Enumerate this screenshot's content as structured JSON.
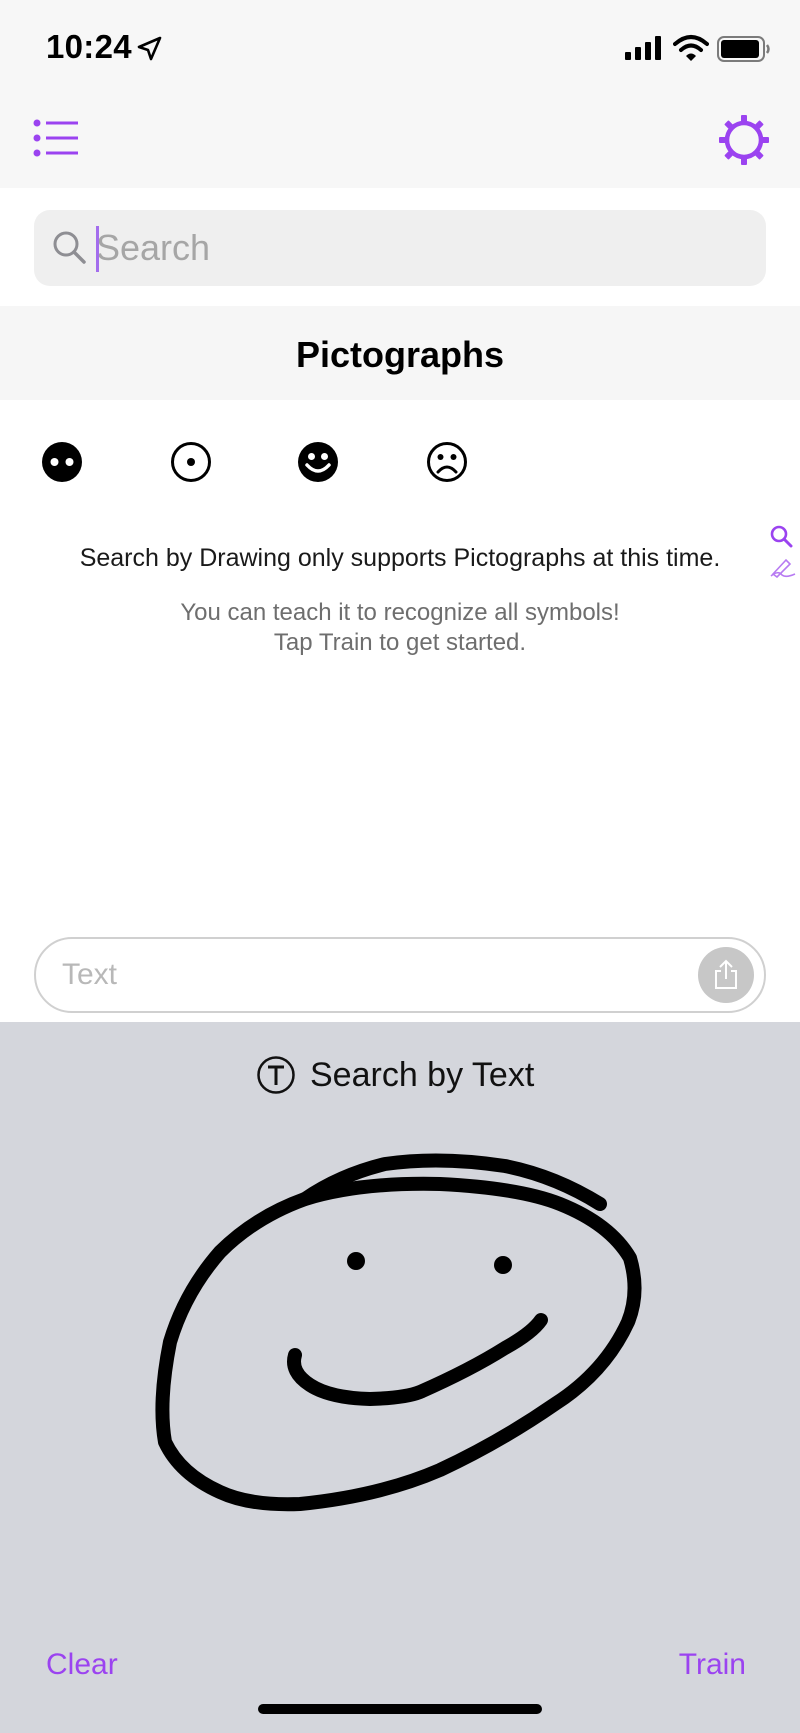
{
  "status_bar": {
    "time": "10:24"
  },
  "search": {
    "placeholder": "Search",
    "value": ""
  },
  "section": {
    "title": "Pictographs"
  },
  "symbols": [
    {
      "icon": "face-two-dots-filled-icon"
    },
    {
      "icon": "circled-dot-icon"
    },
    {
      "icon": "smiley-filled-icon"
    },
    {
      "icon": "frowning-face-icon"
    }
  ],
  "notice": "Search by Drawing only supports Pictographs at this time.",
  "hint": {
    "line1": "You can teach it to recognize all symbols!",
    "line2": "Tap Train to get started."
  },
  "text_field": {
    "placeholder": "Text",
    "value": ""
  },
  "draw_panel": {
    "mode_label": "Search by Text",
    "clear_label": "Clear",
    "train_label": "Train"
  },
  "colors": {
    "accent": "#9b43f0",
    "panel_bg": "#d4d6dc",
    "header_bg": "#f6f6f6"
  }
}
